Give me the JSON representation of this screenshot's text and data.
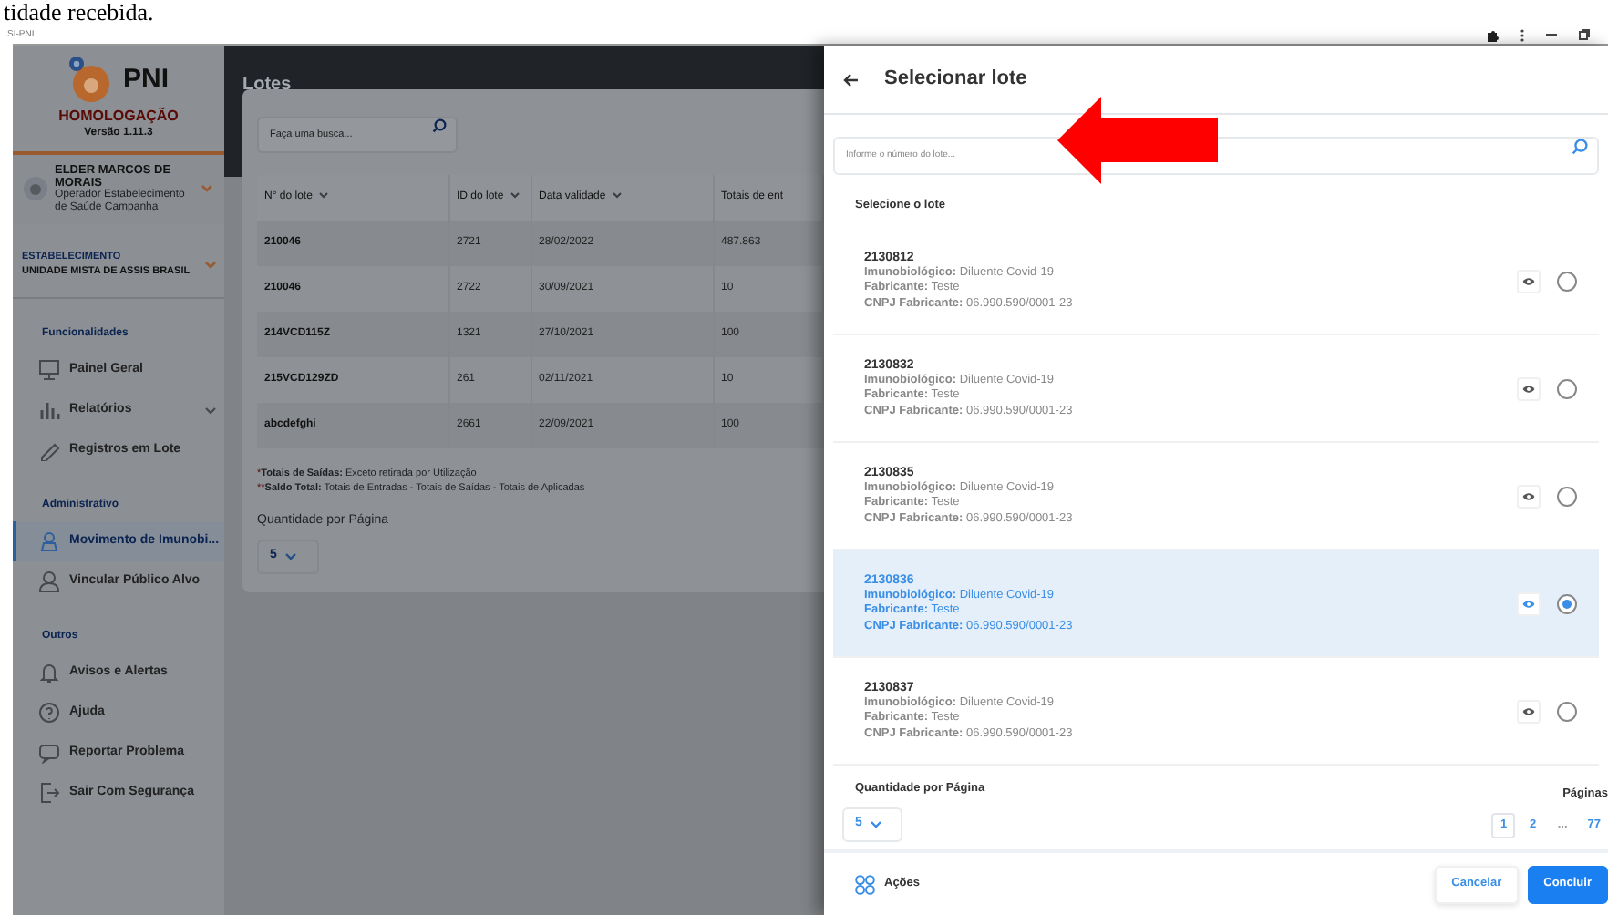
{
  "document_text": "tidade recebida.",
  "window": {
    "title": "SI-PNI"
  },
  "sidebar": {
    "logo": "PNI",
    "environment": "HOMOLOGAÇÃO",
    "version": "Versão 1.11.3",
    "user": {
      "name": "ELDER MARCOS DE MORAIS",
      "role": "Operador Estabelecimento de Saúde Campanha"
    },
    "establishment": {
      "label": "ESTABELECIMENTO",
      "name": "UNIDADE MISTA DE ASSIS BRASIL"
    },
    "sections": [
      {
        "title": "Funcionalidades",
        "items": [
          {
            "label": "Painel Geral",
            "selected": false,
            "has_submenu": false
          },
          {
            "label": "Relatórios",
            "selected": false,
            "has_submenu": true
          },
          {
            "label": "Registros em Lote",
            "selected": false,
            "has_submenu": false
          }
        ]
      },
      {
        "title": "Administrativo",
        "items": [
          {
            "label": "Movimento de Imunobi...",
            "selected": true,
            "has_submenu": false
          },
          {
            "label": "Vincular Público Alvo",
            "selected": false,
            "has_submenu": false
          }
        ]
      },
      {
        "title": "Outros",
        "items": [
          {
            "label": "Avisos e Alertas",
            "selected": false,
            "has_submenu": false
          },
          {
            "label": "Ajuda",
            "selected": false,
            "has_submenu": false
          },
          {
            "label": "Reportar Problema",
            "selected": false,
            "has_submenu": false
          },
          {
            "label": "Sair Com Segurança",
            "selected": false,
            "has_submenu": false
          }
        ]
      }
    ]
  },
  "main": {
    "title": "Lotes",
    "search": {
      "placeholder": "Faça uma busca..."
    },
    "table": {
      "columns": [
        {
          "label": "N° do lote",
          "sortable": true
        },
        {
          "label": "ID do lote",
          "sortable": true
        },
        {
          "label": "Data validade",
          "sortable": true
        },
        {
          "label": "Totais de ent",
          "sortable": false
        }
      ],
      "rows": [
        [
          "210046",
          "2721",
          "28/02/2022",
          "487.863"
        ],
        [
          "210046",
          "2722",
          "30/09/2021",
          "10"
        ],
        [
          "214VCD115Z",
          "1321",
          "27/10/2021",
          "100"
        ],
        [
          "215VCD129ZD",
          "261",
          "02/11/2021",
          "10"
        ],
        [
          "abcdefghi",
          "2661",
          "22/09/2021",
          "100"
        ]
      ]
    },
    "footnotes": [
      {
        "mark": "*",
        "text": "**Totais de Saídas:** Exceto retirada por Utilização"
      },
      {
        "mark": "**",
        "text": "**Saldo Total:** Totais de Entradas - Totais de Saídas - Totais de Aplicadas"
      }
    ],
    "page_size_label": "Quantidade por Página",
    "page_size": "5"
  },
  "drawer": {
    "title": "Selecionar lote",
    "search": {
      "placeholder": "Informe o número do lote..."
    },
    "list_label": "Selecione o lote",
    "lots": [
      {
        "number": "2130812",
        "lines": [
          "**Imunobiológico:** Diluente Covid-19",
          "**Fabricante:** Teste",
          "**CNPJ Fabricante:** 06.990.590/0001-23"
        ],
        "selected": false
      },
      {
        "number": "2130832",
        "lines": [
          "**Imunobiológico:** Diluente Covid-19",
          "**Fabricante:** Teste",
          "**CNPJ Fabricante:** 06.990.590/0001-23"
        ],
        "selected": false
      },
      {
        "number": "2130835",
        "lines": [
          "**Imunobiológico:** Diluente Covid-19",
          "**Fabricante:** Teste",
          "**CNPJ Fabricante:** 06.990.590/0001-23"
        ],
        "selected": false
      },
      {
        "number": "2130836",
        "lines": [
          "**Imunobiológico:** Diluente Covid-19",
          "**Fabricante:** Teste",
          "**CNPJ Fabricante:** 06.990.590/0001-23"
        ],
        "selected": true
      },
      {
        "number": "2130837",
        "lines": [
          "**Imunobiológico:** Diluente Covid-19",
          "**Fabricante:** Teste",
          "**CNPJ Fabricante:** 06.990.590/0001-23"
        ],
        "selected": false
      }
    ],
    "page_size_label": "Quantidade por Página",
    "page_size": "5",
    "pages_label": "Páginas",
    "pages": [
      {
        "label": "1",
        "kind": "page",
        "selected": true
      },
      {
        "label": "2",
        "kind": "page",
        "selected": false
      },
      {
        "label": "...",
        "kind": "ellipsis",
        "selected": false
      },
      {
        "label": "77",
        "kind": "page",
        "selected": false
      }
    ],
    "actions_label": "Ações",
    "buttons": [
      {
        "label": "Cancelar",
        "kind": "secondary"
      },
      {
        "label": "Concluir",
        "kind": "primary"
      }
    ]
  }
}
